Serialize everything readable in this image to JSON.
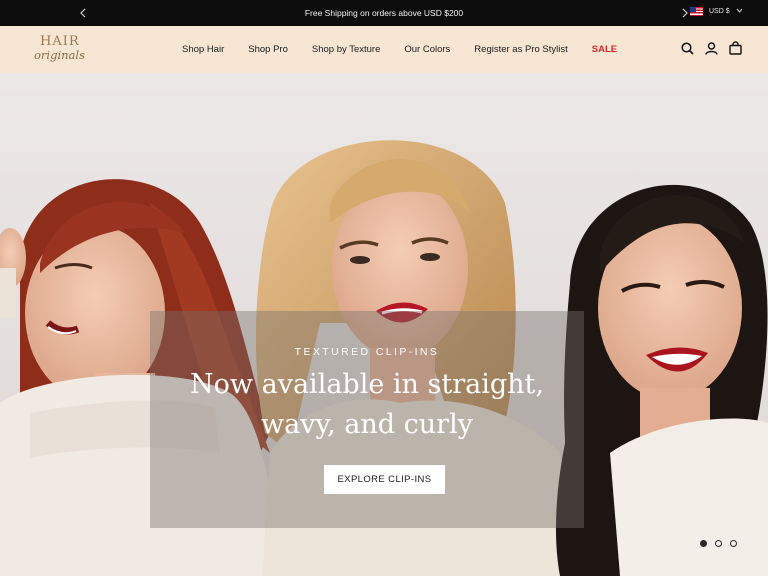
{
  "announcement": {
    "text": "Free Shipping on orders above USD $200",
    "currency": "USD $"
  },
  "brand": {
    "logo_line1": "HAIR",
    "logo_line2": "originals"
  },
  "nav": {
    "items": [
      "Shop Hair",
      "Shop Pro",
      "Shop by Texture",
      "Our Colors",
      "Register as Pro Stylist",
      "SALE"
    ]
  },
  "header_icons": [
    "search-icon",
    "account-icon",
    "cart-icon"
  ],
  "hero": {
    "eyebrow": "TEXTURED CLIP-INS",
    "headline_line1": "Now available in straight,",
    "headline_line2": "wavy, and curly",
    "cta": "EXPLORE CLIP-INS",
    "slides": {
      "count": 3,
      "active": 1
    }
  },
  "colors": {
    "announcement_bg": "#0c0c0c",
    "header_bg": "#f6e6d3",
    "sale": "#d22a2a"
  }
}
